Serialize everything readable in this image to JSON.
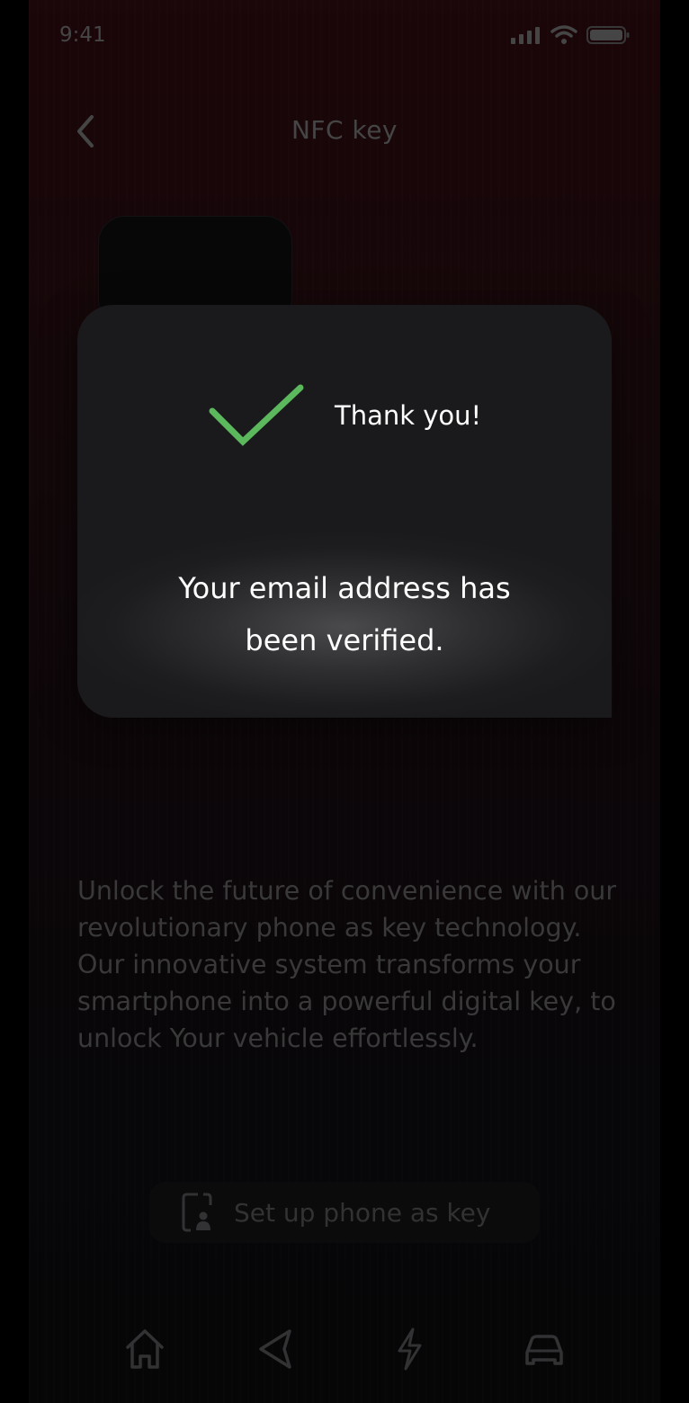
{
  "status_bar": {
    "time": "9:41"
  },
  "header": {
    "title": "NFC key"
  },
  "modal": {
    "heading": "Thank you!",
    "message_line1": "Your email address has",
    "message_line2": "been verified.",
    "check_color": "#5cb85c"
  },
  "description": "Unlock the future of convenience with our revolutionary phone as key technology. Our innovative system transforms your smartphone into a powerful digital key, to unlock Your vehicle effortlessly.",
  "setup_button": {
    "label": "Set up phone as key",
    "icon": "phone-key-icon"
  },
  "tab_bar": {
    "items": [
      "home",
      "navigation",
      "charging",
      "vehicle"
    ]
  }
}
